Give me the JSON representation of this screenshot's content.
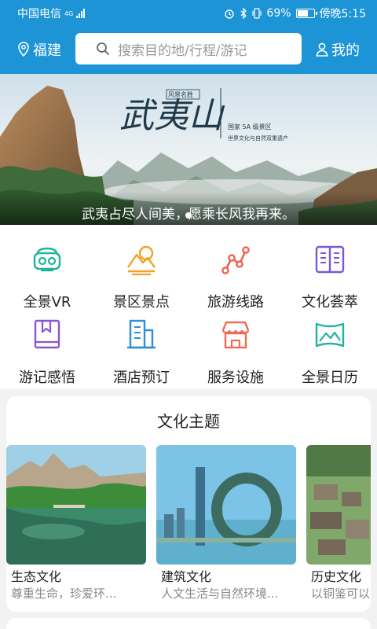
{
  "status_bar": {
    "carrier": "中国电信",
    "network": "4G",
    "battery_text": "69%",
    "battery_level": 0.69,
    "time": "傍晚5:15"
  },
  "header": {
    "location": "福建",
    "search_placeholder": "搜索目的地/行程/游记",
    "mine_label": "我的",
    "accent": "#1c94d6"
  },
  "banner": {
    "caption": "武夷占尽人间美，愿乘长风我再来。",
    "calligraphy": "武夷山",
    "seal_text": "风景名胜",
    "sub_line1": "国家 5A 级景区",
    "sub_line2": "世界文化与自然双重遗产",
    "active_index": 0,
    "dot_count": 1
  },
  "grid": {
    "items": [
      {
        "label": "全景VR",
        "icon": "vr-headset-icon",
        "color": "#1fb39f"
      },
      {
        "label": "景区景点",
        "icon": "mountain-sun-icon",
        "color": "#f2a227"
      },
      {
        "label": "旅游线路",
        "icon": "route-icon",
        "color": "#f0604d"
      },
      {
        "label": "文化荟萃",
        "icon": "open-book-icon",
        "color": "#7b59d6"
      },
      {
        "label": "游记感悟",
        "icon": "bookmark-book-icon",
        "color": "#8a56d6"
      },
      {
        "label": "酒店预订",
        "icon": "building-icon",
        "color": "#2e8fd8"
      },
      {
        "label": "服务设施",
        "icon": "shop-icon",
        "color": "#ef6a57"
      },
      {
        "label": "全景日历",
        "icon": "panorama-icon",
        "color": "#1fb39f"
      }
    ]
  },
  "culture": {
    "title": "文化主题",
    "items": [
      {
        "name": "生态文化",
        "desc": "尊重生命，珍爱环..."
      },
      {
        "name": "建筑文化",
        "desc": "人文生活与自然环境..."
      },
      {
        "name": "历史文化",
        "desc": "以铜鉴可以..."
      }
    ]
  }
}
